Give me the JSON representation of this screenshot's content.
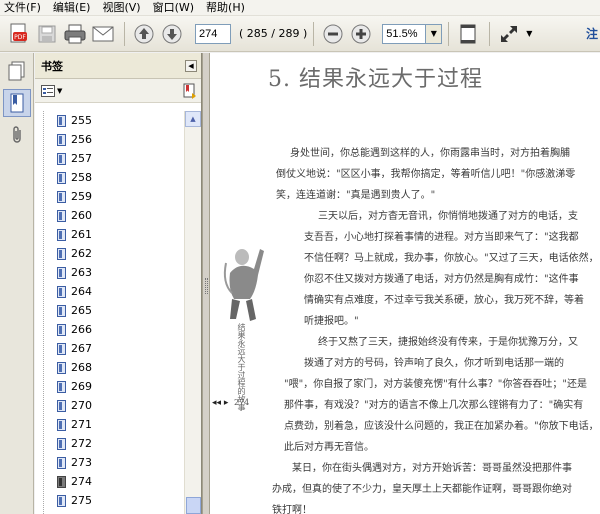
{
  "menu": [
    "文件(F)",
    "编辑(E)",
    "视图(V)",
    "窗口(W)",
    "帮助(H)"
  ],
  "toolbar": {
    "page_value": "274",
    "page_count": "( 285 / 289 )",
    "zoom_value": "51.5%",
    "right_label": "注"
  },
  "bookmarks": {
    "title": "书签",
    "items": [
      "255",
      "256",
      "257",
      "258",
      "259",
      "260",
      "261",
      "262",
      "263",
      "264",
      "265",
      "266",
      "267",
      "268",
      "269",
      "270",
      "271",
      "272",
      "273",
      "274",
      "275"
    ]
  },
  "doc": {
    "title": "5.  结果永远大于过程",
    "p1": [
      "身处世间，你总能遇到这样的人，你雨露串当时，对方拍着胸脯",
      "倒仗义地说：\"区区小事，我帮你搞定，等着听信儿吧！\"你感激涕零",
      "笑，连连道谢：\"真是遇到贵人了。\""
    ],
    "p2": [
      "三天以后，对方杳无音讯，你悄悄地拨通了对方的电话，支",
      "支吾吾，小心地打探着事情的进程。对方当即来气了：\"这我都",
      "不信任啊？马上就成，我办事，你放心。\"又过了三天，电话依然，",
      "你忍不住又拨对方拨通了电话，对方仍然是胸有成竹：\"这件事",
      "情确实有点难度，不过幸亏我关系硬，放心，我万死不辞，等着",
      "听捷报吧。\""
    ],
    "p3": [
      "终于又熬了三天，捷报始终没有传来，于是你犹豫万分，又",
      "拨通了对方的号码，铃声响了良久，你才听到电话那一端的",
      "\"喂\"，你自报了家门，对方装傻充愣\"有什么事？\"你答吞吞吐；\"还是",
      "那件事，有戏没？\"对方的语言不像上几次那么铿锵有力了：\"确实有",
      "点费劲，别着急，应该没什么问题的，我正在加紧办着。\"你放下电话，",
      "此后对方再无音信。"
    ],
    "p4": [
      "某日，你在街头偶遇对方，对方开始诉苦：哥哥虽然没把那件事",
      "办成，但真的使了不少力，皇天厚土上天都能作证啊，哥哥跟你绝对",
      "铁打啊！"
    ],
    "side_caption": "结果永远大于过程的故事",
    "page_number": "274",
    "page_marks": "◂◂ ▸"
  }
}
